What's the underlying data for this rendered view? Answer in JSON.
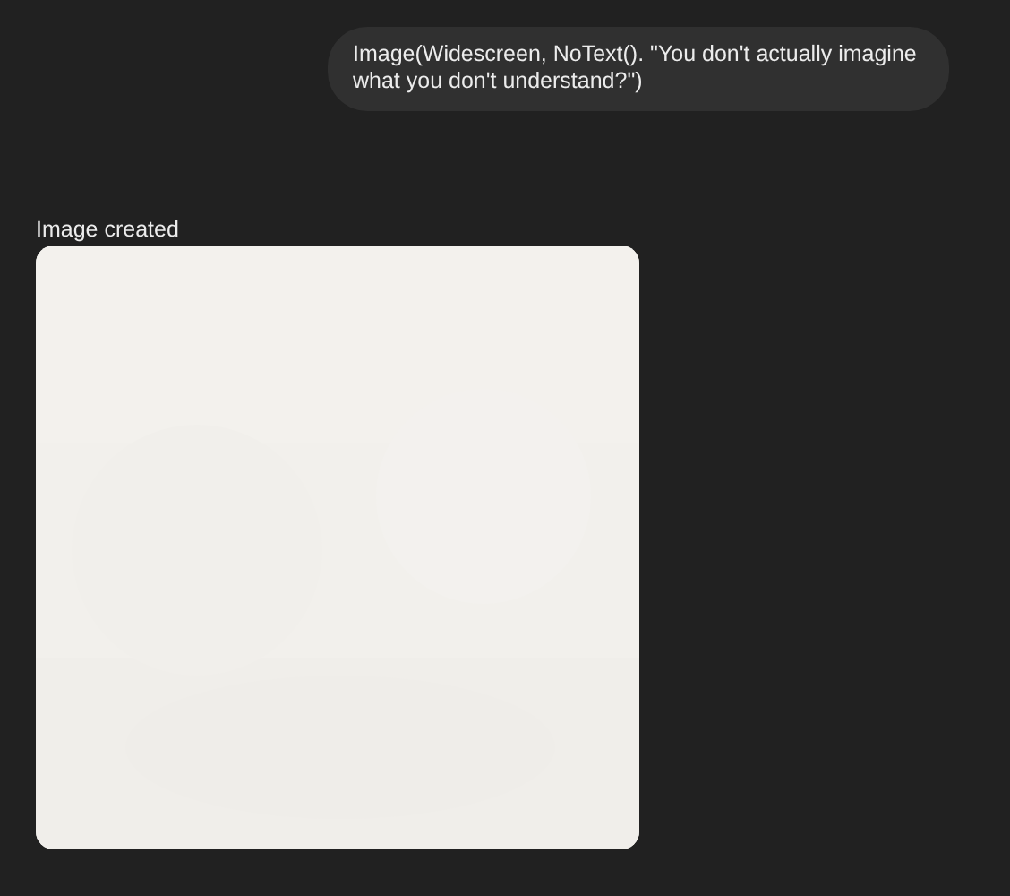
{
  "messages": [
    {
      "kind": "user",
      "text": "Image(Widescreen, NoText(). \"You don't actually imagine what you don't understand?\")"
    },
    {
      "caption": "Image created"
    }
  ]
}
